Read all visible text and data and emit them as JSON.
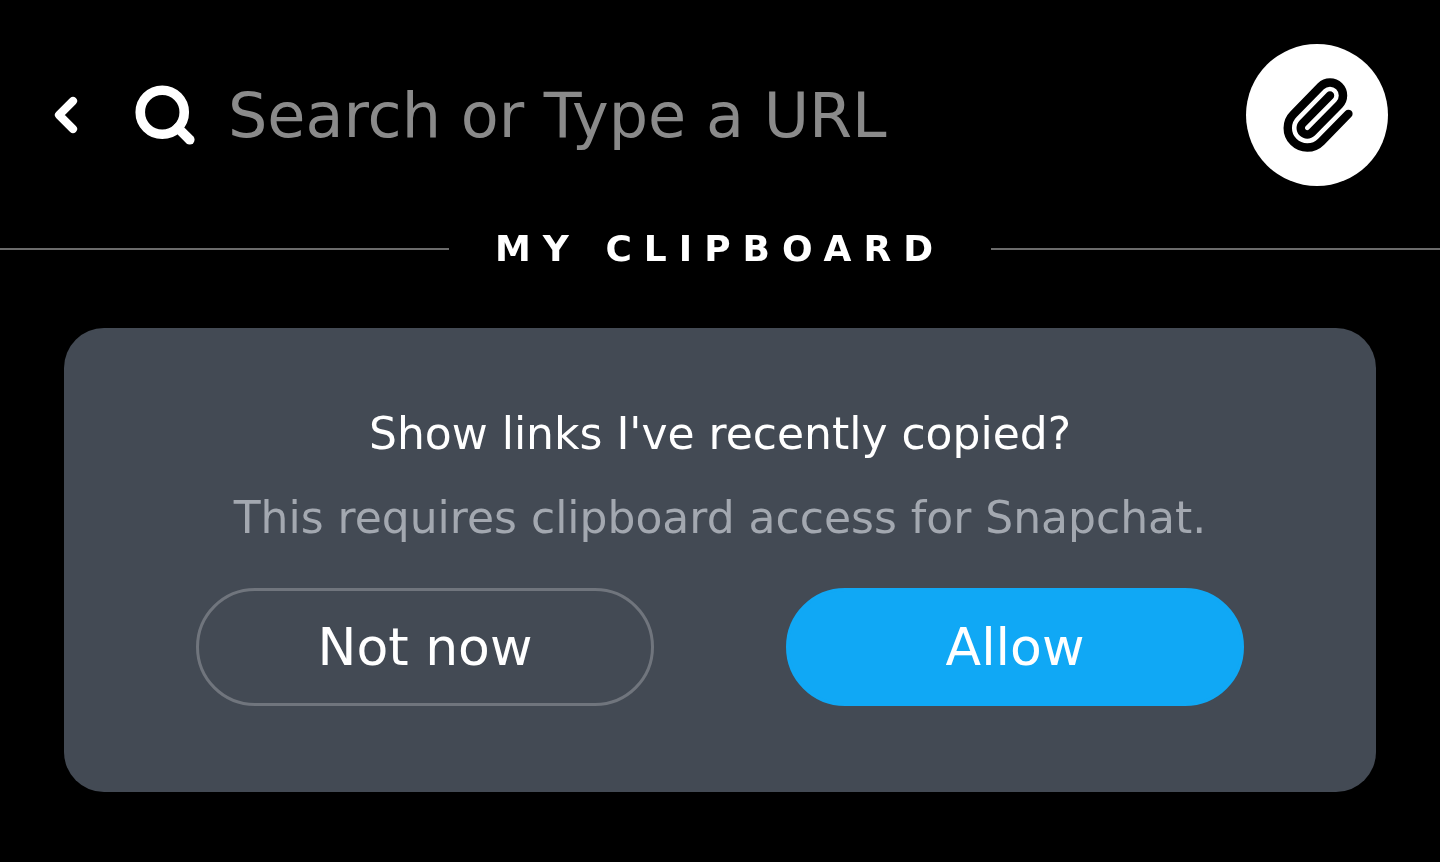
{
  "search": {
    "placeholder": "Search or Type a URL"
  },
  "section_heading": "MY CLIPBOARD",
  "prompt": {
    "title": "Show links I've recently copied?",
    "message": "This requires clipboard access for Snapchat.",
    "buttons": [
      {
        "label": "Not now",
        "kind": "secondary"
      },
      {
        "label": "Allow",
        "kind": "primary"
      }
    ]
  }
}
